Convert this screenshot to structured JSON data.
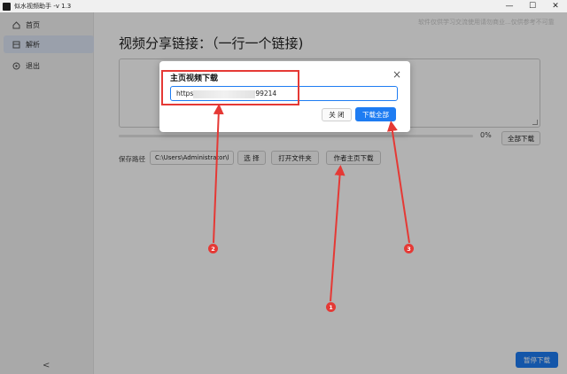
{
  "titlebar": {
    "title": "似水视频助手 -v 1.3",
    "minimize_glyph": "—",
    "maximize_glyph": "☐",
    "close_glyph": "✕"
  },
  "sidebar": {
    "items": [
      {
        "label": "首页",
        "icon": "home-icon"
      },
      {
        "label": "解析",
        "icon": "parse-icon"
      },
      {
        "label": "退出",
        "icon": "exit-icon"
      }
    ],
    "collapse_glyph": "<"
  },
  "main": {
    "watermark": "软件仅供学习交流使用请勿商业...仅供参考不可靠",
    "title": "视频分享链接：（一行一个链接)",
    "progress": {
      "percent": 0,
      "label": "0%"
    },
    "download_all_label": "全部下载",
    "save_path_label": "保存路径",
    "save_path_value": "C:\\Users\\Administrator\\l",
    "choose_label": "选 择",
    "open_folder_label": "打开文件夹",
    "author_download_label": "作者主页下载",
    "pause_label": "暂停下载"
  },
  "modal": {
    "title": "主页视频下载",
    "input_prefix": "https",
    "input_suffix": "99214",
    "close_label": "关 闭",
    "download_all_label": "下载全部",
    "close_glyph": "×"
  },
  "annotations": {
    "markers": [
      "1",
      "2",
      "3"
    ],
    "color": "#e53935"
  },
  "colors": {
    "accent": "#1e7cf2",
    "annotation_red": "#e53935"
  }
}
